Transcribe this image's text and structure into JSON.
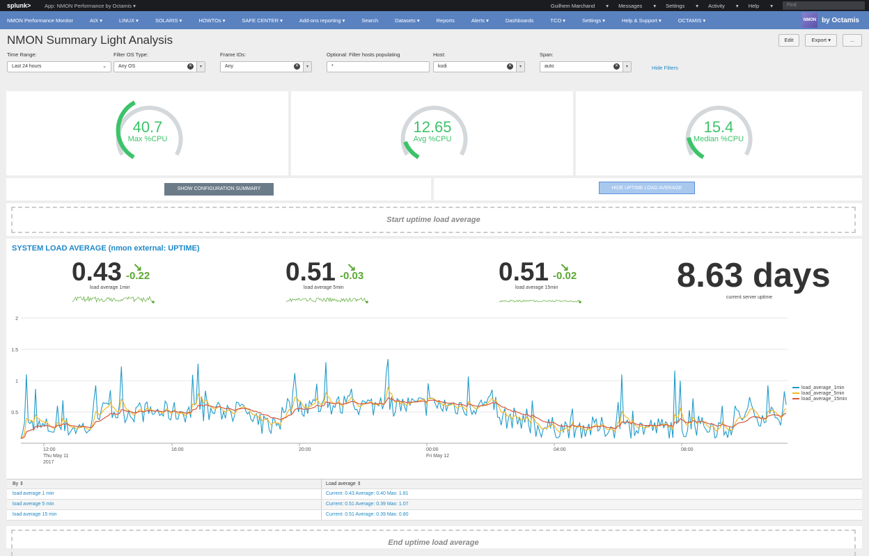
{
  "topbar": {
    "logo": "splunk>",
    "app": "App: NMON Performance by Octamis",
    "user": "Guilhem Marchand",
    "messages": "Messages",
    "settings": "Settings",
    "activity": "Activity",
    "help": "Help",
    "find_placeholder": "Find"
  },
  "nav": {
    "items": [
      "NMON Performance Monitor",
      "AIX",
      "LINUX",
      "SOLARIS",
      "HOWTOs",
      "SAFE CENTER",
      "Add-ons reporting",
      "Search",
      "Datasets",
      "Reports",
      "Alerts",
      "Dashboards",
      "TCO",
      "Settings",
      "Help & Support",
      "OCTAMIS"
    ],
    "brand": "by Octamis",
    "brand_cube": "NMON"
  },
  "page": {
    "title": "NMON Summary Light Analysis",
    "edit": "Edit",
    "export": "Export",
    "more": "..."
  },
  "filters": {
    "time_range_label": "Time Range:",
    "time_range_value": "Last 24 hours",
    "os_label": "Filter OS Type:",
    "os_value": "Any OS",
    "frame_label": "Frame IDs:",
    "frame_value": "Any",
    "opt_label": "Optional: Filter hosts populating",
    "opt_value": "*",
    "host_label": "Host:",
    "host_value": "kodi",
    "span_label": "Span:",
    "span_value": "auto",
    "hide_filters": "Hide Filters"
  },
  "gauges": [
    {
      "value": "40.7",
      "label": "Max %CPU",
      "fraction": 0.407
    },
    {
      "value": "12.65",
      "label": "Avg %CPU",
      "fraction": 0.1265
    },
    {
      "value": "15.4",
      "label": "Median %CPU",
      "fraction": 0.154
    }
  ],
  "buttons": {
    "show_config": "SHOW CONFIGURATION SUMMARY",
    "hide_uptime": "HIDE UPTIME LOAD AVERAGE"
  },
  "sections": {
    "start": "Start uptime load average",
    "end": "End uptime load average",
    "title": "SYSTEM LOAD AVERAGE (nmon external: UPTIME)"
  },
  "singles": [
    {
      "value": "0.43",
      "delta": "-0.22",
      "label": "load average 1min"
    },
    {
      "value": "0.51",
      "delta": "-0.03",
      "label": "load average 5min"
    },
    {
      "value": "0.51",
      "delta": "-0.02",
      "label": "load average 15min"
    },
    {
      "value": "8.63 days",
      "label": "current server uptime"
    }
  ],
  "colors": {
    "accent": "#3cc36a",
    "link": "#1e88c7",
    "series1": "#1f9ac9",
    "series5": "#f2b827",
    "series15": "#d6563c",
    "spark": "#5aa832"
  },
  "chart_data": {
    "type": "line",
    "ylim": [
      0,
      2
    ],
    "yticks": [
      "2",
      "1.5",
      "1",
      "0.5"
    ],
    "xticks": [
      {
        "label": "12:00",
        "sub": "Thu May 11",
        "sub2": "2017"
      },
      {
        "label": "16:00"
      },
      {
        "label": "20:00"
      },
      {
        "label": "00:00",
        "sub": "Fri May 12"
      },
      {
        "label": "04:00"
      },
      {
        "label": "08:00"
      }
    ],
    "series": [
      {
        "name": "load_average_1min",
        "summary": "Current: 0.43 Average: 0.40 Max: 1.81"
      },
      {
        "name": "load_average_5min",
        "summary": "Current: 0.51 Average: 0.39 Max: 1.07"
      },
      {
        "name": "load_average_15min",
        "summary": "Current: 0.51 Average: 0.39 Max: 0.80"
      }
    ]
  },
  "table": {
    "col1": "By",
    "col2": "Load average",
    "rows": [
      {
        "by": "load average 1 min",
        "val": "Current: 0.43 Average: 0.40 Max: 1.81"
      },
      {
        "by": "load average 5 min",
        "val": "Current: 0.51 Average: 0.39 Max: 1.07"
      },
      {
        "by": "load average 15 min",
        "val": "Current: 0.51 Average: 0.39 Max: 0.80"
      }
    ]
  }
}
